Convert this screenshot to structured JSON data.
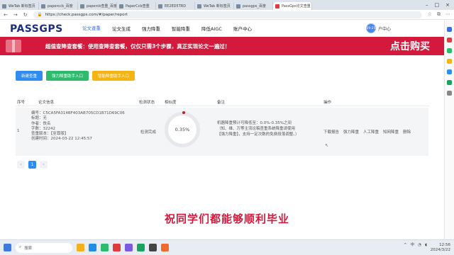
{
  "browser": {
    "tabs": [
      {
        "label": "WeTab 新标签页",
        "active": false
      },
      {
        "label": "paperccb_百度",
        "active": false
      },
      {
        "label": "papercb查重_百度",
        "active": false
      },
      {
        "label": "PaperCcb查重",
        "active": false
      },
      {
        "label": "EE2ED5TRD",
        "active": false
      },
      {
        "label": "WeTab 新标签页",
        "active": false
      },
      {
        "label": "passgps_百度",
        "active": false
      },
      {
        "label": "PassGps论文查重",
        "active": true
      }
    ],
    "url": "https://check.passgps.com/#/paper/report",
    "window_buttons": [
      "–",
      "□",
      "×"
    ]
  },
  "site": {
    "logo": "PASSGPS",
    "nav": [
      {
        "label": "论文查重",
        "active": true
      },
      {
        "label": "论文生成",
        "active": false
      },
      {
        "label": "强力降重",
        "active": false
      },
      {
        "label": "智能降重",
        "active": false
      },
      {
        "label": "降低AIGC",
        "active": false
      },
      {
        "label": "账户中心",
        "active": false
      }
    ],
    "user": {
      "avatar_text": "09:25",
      "label": "户中心"
    }
  },
  "banner": {
    "text": "超值查降查套餐：使用查降查套餐，仅仅只需3个步骤，真正实现论文一遍过！",
    "cta": "点击购买"
  },
  "actions": {
    "new_check": "新建查重",
    "strong_entry": "强力降重助手入口",
    "smart_entry": "智能降重助手入口"
  },
  "table": {
    "headers": [
      "序号",
      "论文信息",
      "检测状态",
      "相似度",
      "备注",
      "操作"
    ],
    "rows": [
      {
        "index": "1",
        "info": {
          "id": "编号：C5CA5FA314BF403AB705CD1B71D69C06",
          "title": "标题：无",
          "author": "作者：佚名",
          "words": "字数：32242",
          "version": "查重版本：【至尊版】",
          "created": "创建时间：2024-03-22 12:45:57"
        },
        "status": "检测完成",
        "similarity": "0.35%",
        "remark": [
          "机器降重预计可降低至：0.0%-0.35%之间",
          "（知、维、万等主流论稿查重系统降重请使用",
          "【强力降重】，支持一定次数的免费段落调整。）"
        ],
        "ops": [
          "下载报告",
          "强力降重",
          "人工降重",
          "知网降重",
          "删除"
        ]
      }
    ]
  },
  "pager": {
    "prev": "‹",
    "current": "1",
    "next": "›"
  },
  "caption": "祝同学们都能够顺利毕业",
  "taskbar": {
    "search_placeholder": "搜索",
    "time": "12:56",
    "date": "2024/3/22",
    "ime": "中"
  },
  "colors": {
    "brand": "#1c2f7e",
    "accent": "#3c6de0",
    "banner": "#d3193c",
    "btn_blue": "#2f8cf0",
    "btn_green": "#2dbb6c",
    "btn_yellow": "#f5b412"
  }
}
